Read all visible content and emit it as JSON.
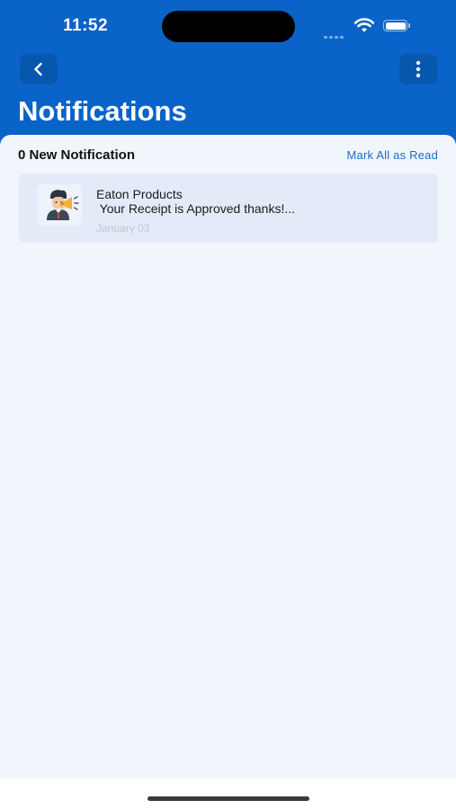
{
  "status_bar": {
    "time": "11:52",
    "icons": [
      "signal-icon",
      "wifi-icon",
      "battery-icon"
    ]
  },
  "nav": {
    "back_icon": "chevron-left-icon",
    "more_icon": "more-vertical-icon"
  },
  "header": {
    "title": "Notifications"
  },
  "summary": {
    "count_label": "0 New Notification",
    "mark_all_label": "Mark All as Read"
  },
  "notifications": [
    {
      "sender": "Eaton Products",
      "message": " Your Receipt is Approved thanks!...",
      "date": "January 03",
      "icon": "announcer-avatar-icon",
      "read": true
    }
  ],
  "colors": {
    "header_bg": "#0a63c8",
    "content_bg": "#f1f6fd",
    "card_bg": "#e4ebf8",
    "accent_link": "#1a6cc7"
  }
}
